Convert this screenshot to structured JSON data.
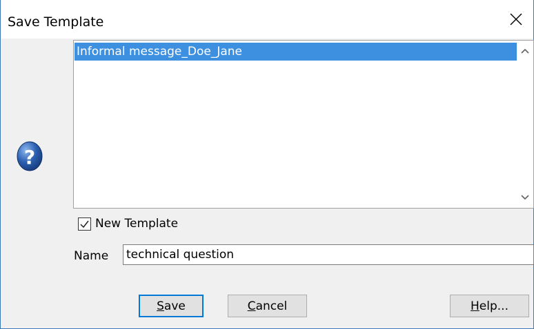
{
  "window": {
    "title": "Save Template",
    "close_icon": "close-icon"
  },
  "icon": {
    "name": "question-icon",
    "color": "#2b5fb1"
  },
  "template_list": {
    "items": [
      {
        "label": "Informal message_Doe_Jane",
        "selected": true
      }
    ],
    "selection_color": "#3d8fe0"
  },
  "new_template": {
    "label": "New Template",
    "checked": true
  },
  "name_field": {
    "label": "Name",
    "value": "technical question"
  },
  "buttons": {
    "save": {
      "mnemonic": "S",
      "rest": "ave"
    },
    "cancel": {
      "mnemonic": "C",
      "rest": "ancel"
    },
    "help": {
      "mnemonic": "H",
      "rest": "elp..."
    }
  }
}
